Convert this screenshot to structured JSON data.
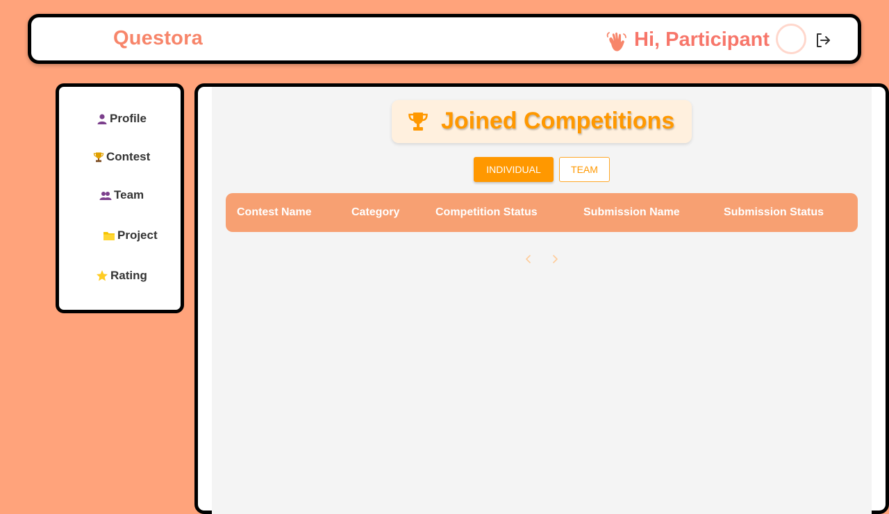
{
  "header": {
    "brand": "Questora",
    "greeting": "Hi, Participant",
    "icons": {
      "wave": "waving-hand-icon",
      "logout": "logout-icon"
    }
  },
  "sidebar": {
    "items": [
      {
        "label": "Profile",
        "icon": "user-icon"
      },
      {
        "label": "Contest",
        "icon": "trophy-icon"
      },
      {
        "label": "Team",
        "icon": "team-icon"
      },
      {
        "label": "Project",
        "icon": "folder-icon"
      },
      {
        "label": "Rating",
        "icon": "star-icon"
      }
    ]
  },
  "main": {
    "title": "Joined Competitions",
    "tabs": [
      {
        "label": "INDIVIDUAL",
        "active": true
      },
      {
        "label": "TEAM",
        "active": false
      }
    ],
    "table": {
      "columns": [
        "Contest Name",
        "Category",
        "Competition Status",
        "Submission Name",
        "Submission Status"
      ],
      "rows": []
    },
    "pagination": {
      "prev_icon": "chevron-left-icon",
      "next_icon": "chevron-right-icon"
    }
  },
  "colors": {
    "background": "#ffa37b",
    "accent": "#ff9800",
    "brand": "#f7856a",
    "table_header": "#f7a072"
  }
}
